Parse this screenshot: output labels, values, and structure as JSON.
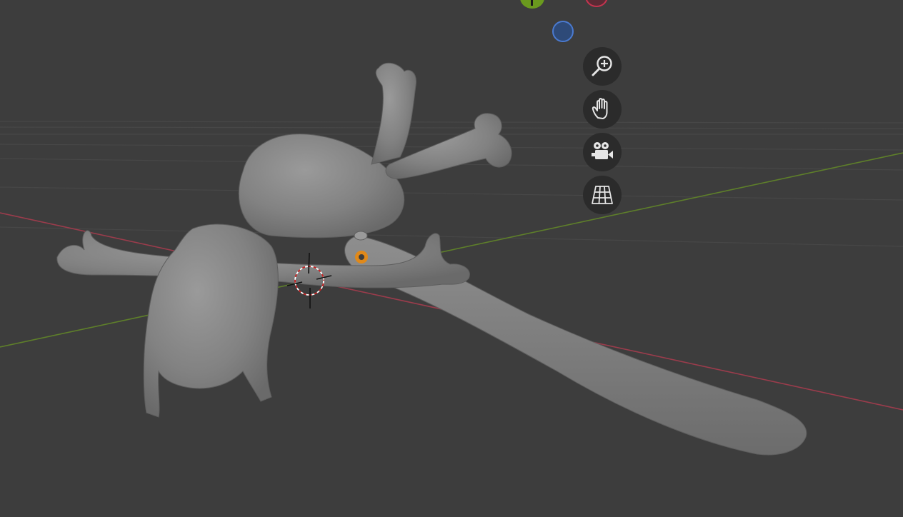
{
  "viewport": {
    "background": "#3d3d3d",
    "grid_color": "#474747",
    "x_axis_color": "#9b3c4c",
    "y_axis_color": "#5e7f2a",
    "mesh_color": "#8a8a8a"
  },
  "gizmo": {
    "x_color": "#c4344f",
    "y_color": "#6a9a1e",
    "z_color": "#4a7ad0"
  },
  "navigation": {
    "buttons": [
      {
        "name": "zoom-button",
        "icon": "zoom-in-icon"
      },
      {
        "name": "pan-button",
        "icon": "hand-icon"
      },
      {
        "name": "camera-view-button",
        "icon": "camera-icon"
      },
      {
        "name": "perspective-toggle-button",
        "icon": "grid-icon"
      }
    ]
  }
}
